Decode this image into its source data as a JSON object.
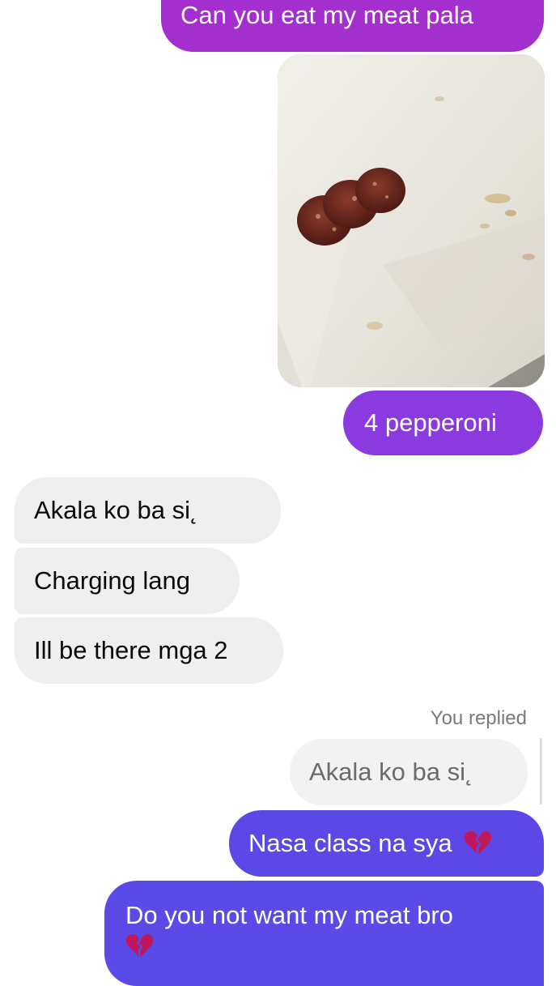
{
  "messages": {
    "m1": "Can you eat my meat pala",
    "m2": "4 pepperoni",
    "m3": "Akala ko ba si",
    "m3_trailing": "˛",
    "m4": "Charging lang",
    "m5": "Ill be there mga 2",
    "replied_label": "You replied",
    "quoted": "Akala ko ba si",
    "quoted_trailing": "˛",
    "m6": "Nasa class na sya",
    "m7": "Do you not want my meat bro"
  },
  "icons": {
    "broken_heart": "broken-heart-emoji"
  },
  "colors": {
    "sent_top": "#a42fcf",
    "sent_mid": "#8b3ae0",
    "sent_bottom": "#5a4be8",
    "received": "#efefef",
    "heart": "#c2185b"
  }
}
